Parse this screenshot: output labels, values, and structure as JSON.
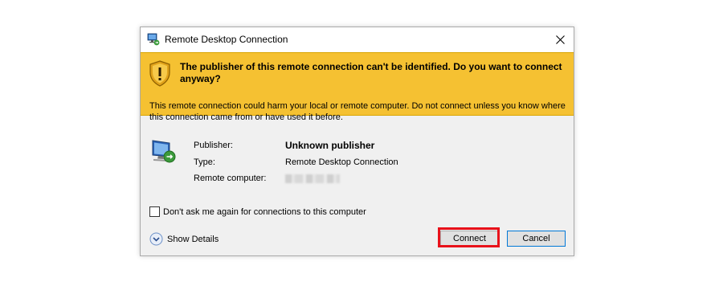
{
  "window": {
    "title": "Remote Desktop Connection",
    "title_icon": "remote-desktop-icon",
    "close_icon": "close-icon"
  },
  "banner": {
    "icon": "warning-shield-icon",
    "message": "The publisher of this remote connection can't be identified. Do you want to connect anyway?",
    "color": "#f5c132"
  },
  "body": {
    "warning": "This remote connection could harm your local or remote computer. Do not connect unless you know where this connection came from or have used it before.",
    "monitor_icon": "remote-desktop-monitor-icon",
    "info": {
      "publisher_label": "Publisher:",
      "publisher_value": "Unknown publisher",
      "type_label": "Type:",
      "type_value": "Remote Desktop Connection",
      "remote_label": "Remote computer:"
    }
  },
  "options": {
    "dont_ask_label": "Don't ask me again for connections to this computer",
    "dont_ask_checked": false,
    "show_details_label": "Show Details",
    "show_details_icon": "chevron-down-circle-icon"
  },
  "buttons": {
    "connect": "Connect",
    "cancel": "Cancel"
  },
  "colors": {
    "highlight": "#e8111a",
    "focus_border": "#0078d7"
  }
}
